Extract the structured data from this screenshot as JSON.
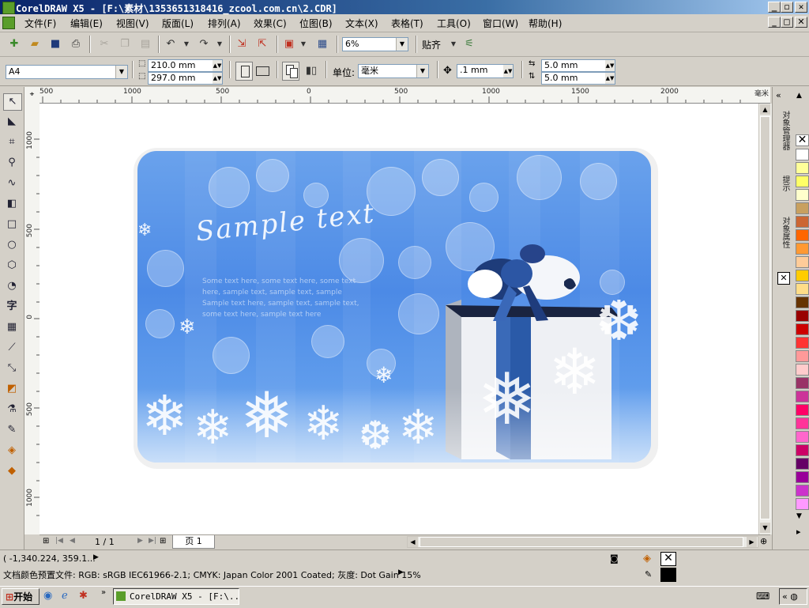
{
  "window": {
    "title": "CorelDRAW X5 - [F:\\素材\\1353651318416_zcool.com.cn\\2.CDR]",
    "controls": [
      "_",
      "◻",
      "✕"
    ],
    "doc_controls": [
      "_",
      "◻",
      "✕"
    ]
  },
  "menu": [
    "文件(F)",
    "编辑(E)",
    "视图(V)",
    "版面(L)",
    "排列(A)",
    "效果(C)",
    "位图(B)",
    "文本(X)",
    "表格(T)",
    "工具(O)",
    "窗口(W)",
    "帮助(H)"
  ],
  "toolbar": {
    "zoom": "6%",
    "snap_label": "贴齐"
  },
  "property_bar": {
    "paper_size": "A4",
    "width": "210.0 mm",
    "height": "297.0 mm",
    "unit_label": "单位:",
    "unit": "毫米",
    "nudge": ".1 mm",
    "dup_x": "5.0 mm",
    "dup_y": "5.0 mm"
  },
  "rulers": {
    "h_labels": [
      "500",
      "1000",
      "500",
      "0",
      "500",
      "1000",
      "1500",
      "2000"
    ],
    "h_unit": "毫米",
    "v_labels": [
      "1000",
      "500",
      "0",
      "500",
      "1000"
    ]
  },
  "artwork": {
    "script_title": "Sample text",
    "body_lines": [
      "Some text here, some text here, some text",
      "here, sample text, sample text, sample",
      "Sample text here, sample text, sample text,",
      "some text here, sample text here"
    ]
  },
  "dockers": [
    "对象管理器",
    "提示",
    "对象属性"
  ],
  "palette": {
    "colors": [
      "#ffffff",
      "#ffff99",
      "#ffff66",
      "#ffffcc",
      "#c8a060",
      "#cc6633",
      "#ff6600",
      "#ff9933",
      "#ffcc99",
      "#ffcc00",
      "#ffdd88",
      "#663300",
      "#990000",
      "#cc0000",
      "#ff3333",
      "#ff9999",
      "#ffcccc",
      "#993366",
      "#cc3399",
      "#ff0066",
      "#ff3399",
      "#ff66cc",
      "#cc0066",
      "#660066",
      "#990099",
      "#cc33cc",
      "#ff99ff"
    ]
  },
  "pagebar": {
    "page_count": "1 / 1",
    "page_tab": "页 1"
  },
  "status": {
    "coords": "( -1,340.224, 359.1...",
    "color_profile": "文档颜色预置文件: RGB: sRGB IEC61966-2.1; CMYK: Japan Color 2001 Coated; 灰度: Dot Gain 15%"
  },
  "taskbar": {
    "start": "开始",
    "task": "CorelDRAW X5 - [F:\\..."
  }
}
